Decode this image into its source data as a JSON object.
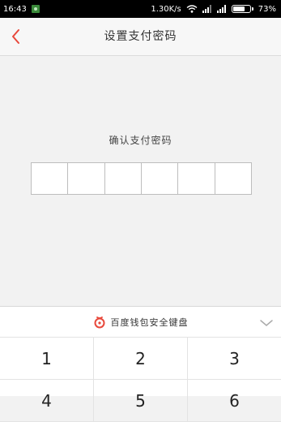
{
  "status_bar": {
    "time": "16:43",
    "network_speed": "1.30K/s",
    "battery_percent": "73%",
    "battery_level": 0.73
  },
  "header": {
    "title": "设置支付密码",
    "back_icon": "chevron-left-icon",
    "accent_color": "#e8483b"
  },
  "main": {
    "confirm_label": "确认支付密码",
    "pin_length": 6
  },
  "keyboard": {
    "title": "百度钱包安全键盘",
    "logo_icon": "baidu-wallet-icon",
    "collapse_icon": "chevron-down-icon",
    "rows": [
      [
        "1",
        "2",
        "3"
      ],
      [
        "4",
        "5",
        "6"
      ]
    ]
  }
}
